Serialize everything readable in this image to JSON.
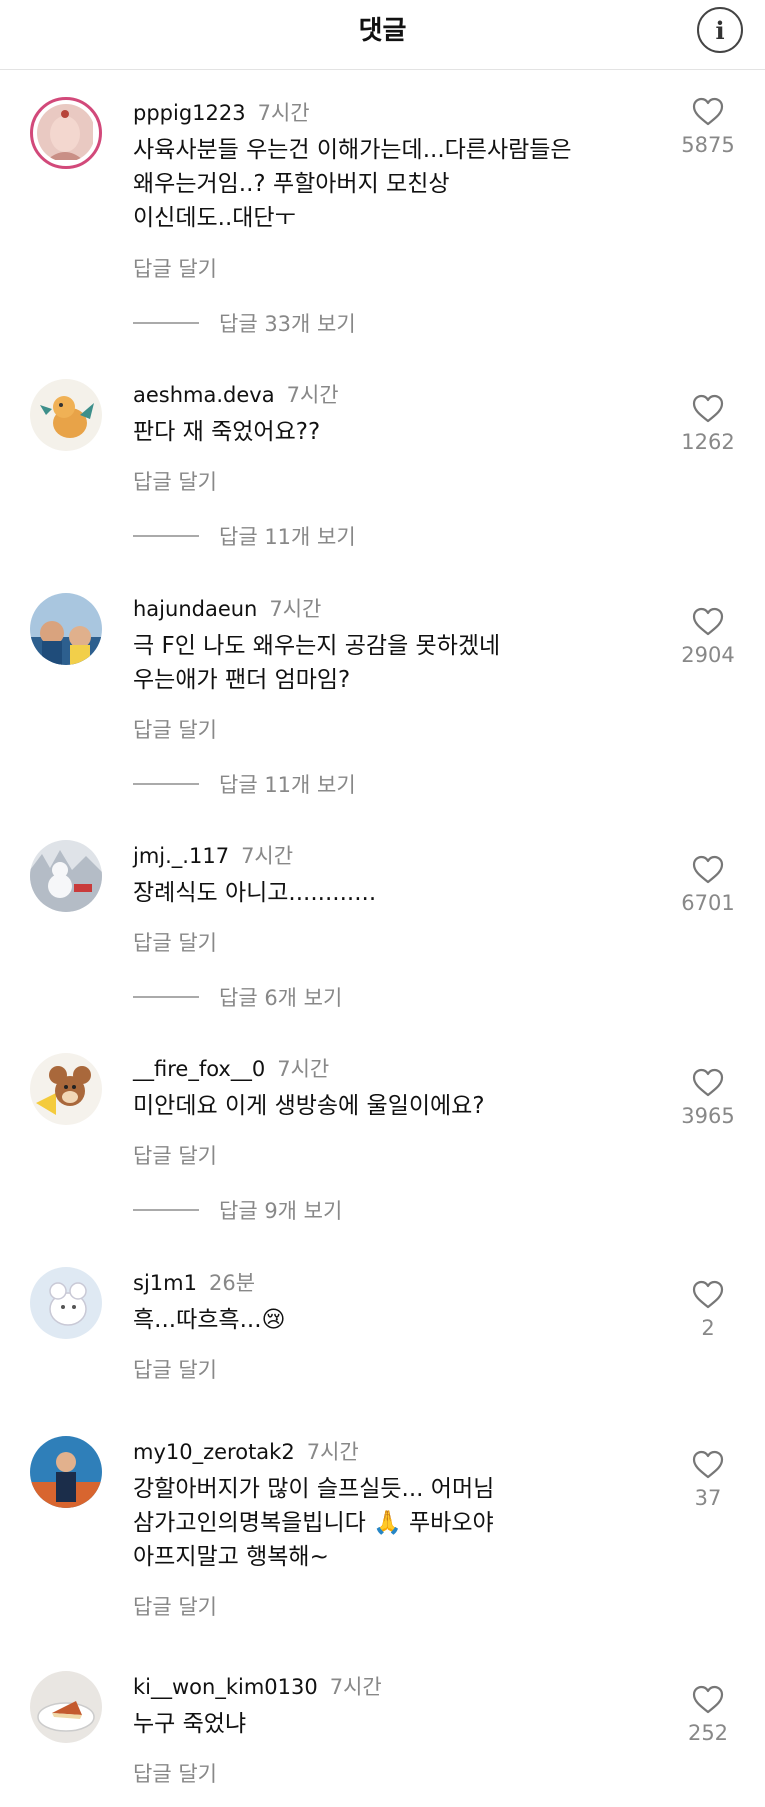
{
  "header": {
    "title": "댓글",
    "info_icon": "info-icon"
  },
  "reply_label": "답글 달기",
  "comments": [
    {
      "username": "pppig1223",
      "time": "7시간",
      "text": "사육사분들 우는건 이해가는데...다른사람들은\n왜우는거임..? 푸할아버지 모친상\n이신데도..대단ㅜ",
      "likes": "5875",
      "replies": "답글 33개 보기"
    },
    {
      "username": "aeshma.deva",
      "time": "7시간",
      "text": "판다 재 죽었어요??",
      "likes": "1262",
      "replies": "답글 11개 보기"
    },
    {
      "username": "hajundaeun",
      "time": "7시간",
      "text": "극 F인 나도 왜우는지 공감을 못하겠네\n우는애가 팬더 엄마임?",
      "likes": "2904",
      "replies": "답글 11개 보기"
    },
    {
      "username": "jmj._.117",
      "time": "7시간",
      "text": "장례식도 아니고............",
      "likes": "6701",
      "replies": "답글 6개 보기"
    },
    {
      "username": "__fire_fox__0",
      "time": "7시간",
      "text": "미안데요 이게 생방송에 울일이에요?",
      "likes": "3965",
      "replies": "답글 9개 보기"
    },
    {
      "username": "sj1m1",
      "time": "26분",
      "text": "흑...따흐흑...😢",
      "likes": "2"
    },
    {
      "username": "my10_zerotak2",
      "time": "7시간",
      "text": "강할아버지가 많이 슬프실듯... 어머님\n삼가고인의명복을빕니다 🙏 푸바오야\n아프지말고 행복해~",
      "likes": "37"
    },
    {
      "username": "ki__won_kim0130",
      "time": "7시간",
      "text": "누구 죽었냐",
      "likes": "252"
    }
  ]
}
